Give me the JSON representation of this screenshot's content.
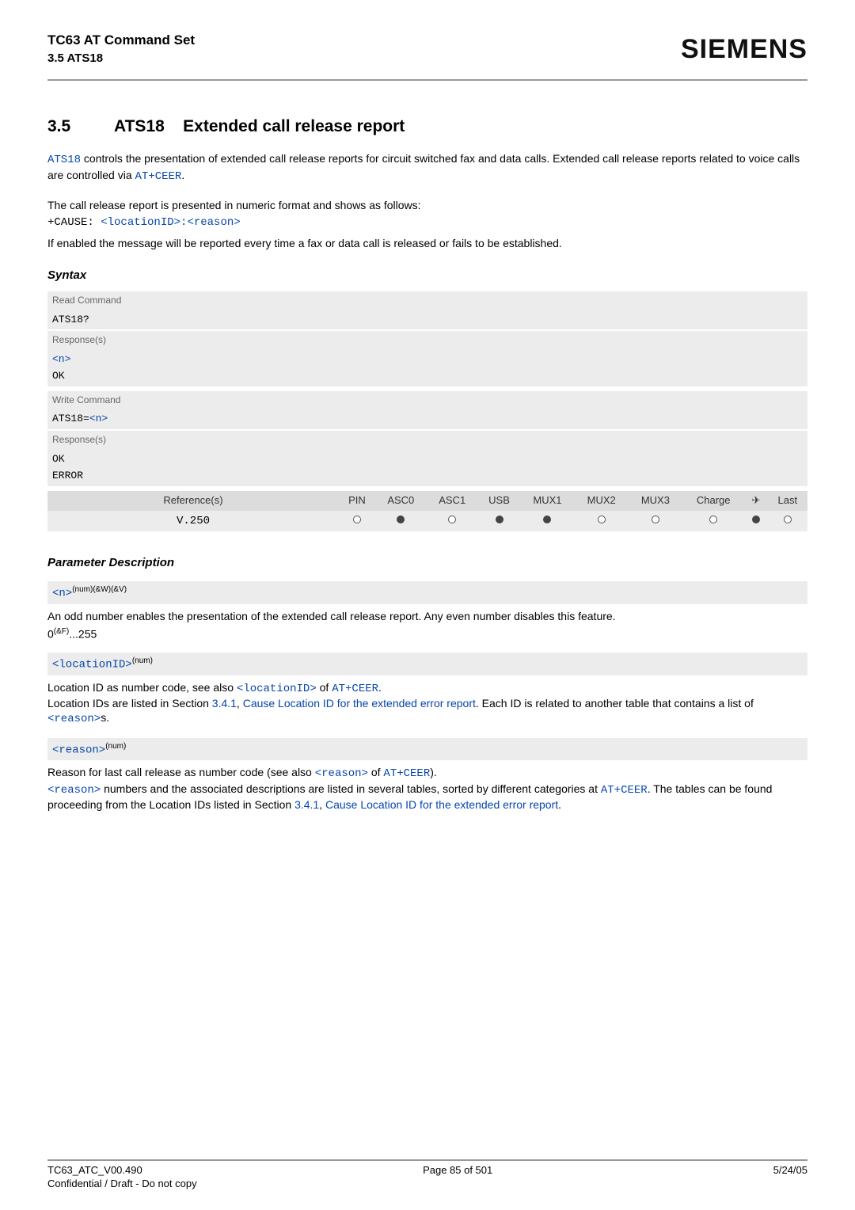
{
  "header": {
    "line1": "TC63 AT Command Set",
    "line2": "3.5 ATS18",
    "brand": "SIEMENS"
  },
  "section": {
    "number": "3.5",
    "title_cmd": "ATS18",
    "title_rest": "Extended call release report"
  },
  "intro": {
    "p1a": "ATS18",
    "p1b": " controls the presentation of extended call release reports for circuit switched fax and data calls. Extended call release reports related to voice calls are controlled via ",
    "p1c": "AT+CEER",
    "p1d": ".",
    "p2": "The call release report is presented in numeric format and shows as follows:",
    "cause_prefix": "+CAUSE:",
    "cause_loc": "<locationID>",
    "cause_sep": ":",
    "cause_reason": "<reason>",
    "p3": "If enabled the message will be reported every time a fax or data call is released or fails to be established."
  },
  "syntax": {
    "label": "Syntax",
    "read_label": "Read Command",
    "read_cmd": "ATS18?",
    "resp_label": "Response(s)",
    "read_resp_n": "<n>",
    "read_resp_ok": "OK",
    "write_label": "Write Command",
    "write_cmd_pre": "ATS18=",
    "write_cmd_n": "<n>",
    "write_resp_ok": "OK",
    "write_resp_err": "ERROR",
    "ref_label": "Reference(s)",
    "ref_value": "V.250",
    "cols": {
      "pin": "PIN",
      "asc0": "ASC0",
      "asc1": "ASC1",
      "usb": "USB",
      "mux1": "MUX1",
      "mux2": "MUX2",
      "mux3": "MUX3",
      "charge": "Charge",
      "air": "✈",
      "last": "Last"
    }
  },
  "params": {
    "label": "Parameter Description",
    "n_tag": "<n>",
    "n_sup": "(num)(&W)(&V)",
    "n_desc": "An odd number enables the presentation of the extended call release report. Any even number disables this feature.",
    "n_range_a": "0",
    "n_range_sup": "(&F)",
    "n_range_b": "...255",
    "loc_tag": "<locationID>",
    "loc_sup": "(num)",
    "loc_p1a": "Location ID as number code, see also ",
    "loc_p1b": "<locationID>",
    "loc_p1c": " of ",
    "loc_p1d": "AT+CEER",
    "loc_p1e": ".",
    "loc_p2a": "Location IDs are listed in Section ",
    "loc_p2b": "3.4.1",
    "loc_p2c": ", ",
    "loc_p2d": "Cause Location ID for the extended error report",
    "loc_p2e": ". Each ID is related to another table that contains a list of ",
    "loc_p2f": "<reason>",
    "loc_p2g": "s.",
    "reason_tag": "<reason>",
    "reason_sup": "(num)",
    "reason_p1a": "Reason for last call release as number code (see also ",
    "reason_p1b": "<reason>",
    "reason_p1c": " of ",
    "reason_p1d": "AT+CEER",
    "reason_p1e": ").",
    "reason_p2a": "<reason>",
    "reason_p2b": " numbers and the associated descriptions are listed in several tables, sorted by different categories at ",
    "reason_p2c": "AT+CEER",
    "reason_p2d": ". The tables can be found proceeding from the Location IDs listed in Section ",
    "reason_p2e": "3.4.1",
    "reason_p2f": ", ",
    "reason_p2g": "Cause Location ID for the extended error report",
    "reason_p2h": "."
  },
  "footer": {
    "doc": "TC63_ATC_V00.490",
    "page": "Page 85 of 501",
    "date": "5/24/05",
    "conf": "Confidential / Draft - Do not copy"
  }
}
